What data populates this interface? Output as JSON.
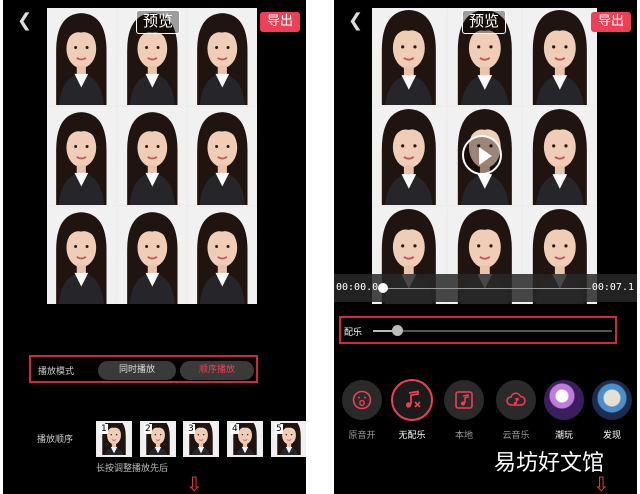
{
  "left_screen": {
    "title": "预览",
    "export_label": "导出",
    "play_mode": {
      "label": "播放模式",
      "options": [
        "同时播放",
        "顺序播放"
      ],
      "selected": "顺序播放"
    },
    "play_order": {
      "label": "播放顺序",
      "thumbnails": [
        "1",
        "2",
        "3",
        "4",
        "5"
      ],
      "hint": "长按调整播放先后"
    }
  },
  "right_screen": {
    "title": "预览",
    "export_label": "导出",
    "time_start": "00:00.0",
    "time_end": "00:07.1",
    "music": {
      "label": "配乐",
      "level": 0.1
    },
    "music_options": [
      {
        "label": "原音开",
        "icon": "mouth-icon"
      },
      {
        "label": "无配乐",
        "icon": "no-music-icon",
        "selected": true
      },
      {
        "label": "本地",
        "icon": "local-music-icon"
      },
      {
        "label": "云音乐",
        "icon": "cloud-music-icon"
      },
      {
        "label": "潮玩",
        "icon": "album-art"
      },
      {
        "label": "发现",
        "icon": "album-art"
      }
    ]
  },
  "watermark": "易坊好文馆",
  "colors": {
    "accent": "#ee3f57",
    "highlight_box": "#d2283a",
    "background": "#000000"
  }
}
